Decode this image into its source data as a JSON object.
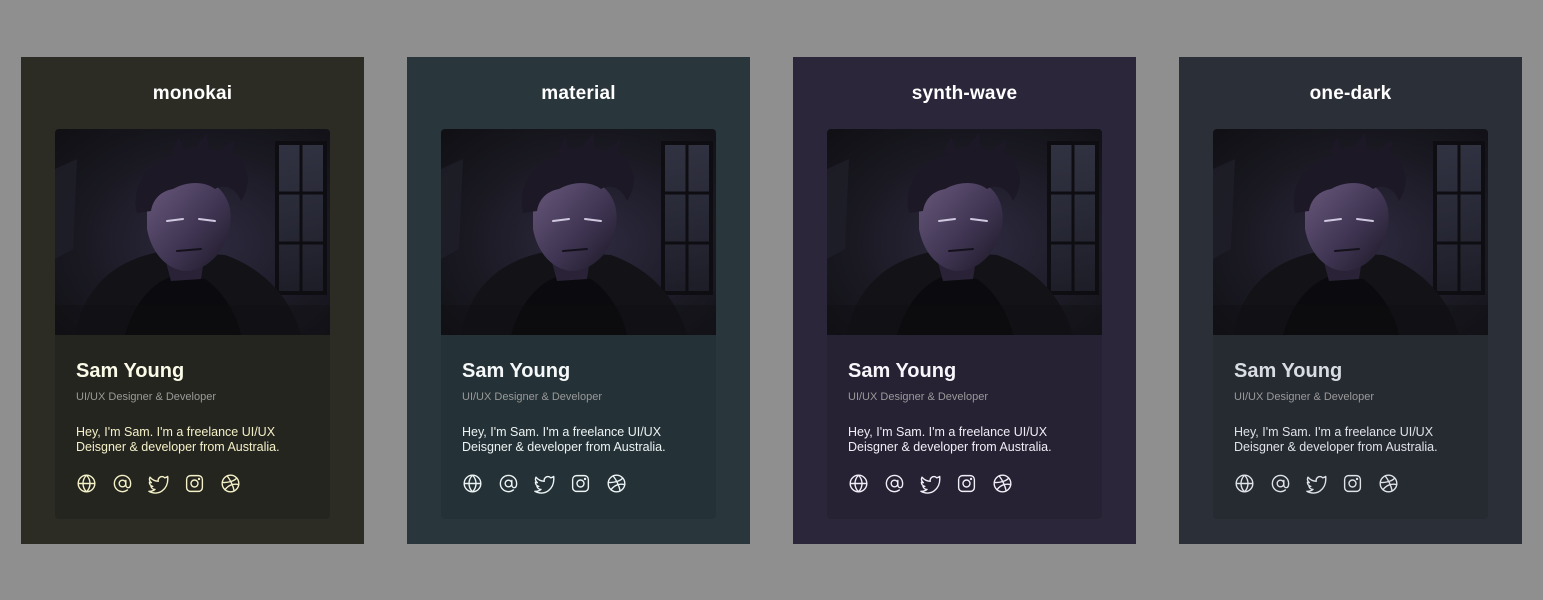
{
  "themes": [
    {
      "title": "monokai",
      "panel_bg": "#2c2c24",
      "card_bg": "#25251f",
      "name_color": "#fbfbe8",
      "bio_color": "#f4f0c8",
      "profile": {
        "name": "Sam Young",
        "role": "UI/UX Designer & Developer",
        "bio": "Hey, I'm Sam. I'm a freelance UI/UX Deisgner & developer from Australia."
      },
      "socials": [
        "globe-icon",
        "at-sign-icon",
        "twitter-icon",
        "instagram-icon",
        "dribbble-icon"
      ]
    },
    {
      "title": "material",
      "panel_bg": "#29363b",
      "card_bg": "#243136",
      "name_color": "#f5f8f8",
      "bio_color": "#ecf3f4",
      "profile": {
        "name": "Sam Young",
        "role": "UI/UX Designer & Developer",
        "bio": "Hey, I'm Sam. I'm a freelance UI/UX Deisgner & developer from Australia."
      },
      "socials": [
        "globe-icon",
        "at-sign-icon",
        "twitter-icon",
        "instagram-icon",
        "dribbble-icon"
      ]
    },
    {
      "title": "synth-wave",
      "panel_bg": "#2b263a",
      "card_bg": "#262133",
      "name_color": "#f8f6fb",
      "bio_color": "#f0eef6",
      "profile": {
        "name": "Sam Young",
        "role": "UI/UX Designer & Developer",
        "bio": "Hey, I'm Sam. I'm a freelance UI/UX Deisgner & developer from Australia."
      },
      "socials": [
        "globe-icon",
        "at-sign-icon",
        "twitter-icon",
        "instagram-icon",
        "dribbble-icon"
      ]
    },
    {
      "title": "one-dark",
      "panel_bg": "#2b2f37",
      "card_bg": "#262a31",
      "name_color": "#d9dde3",
      "bio_color": "#dfe3e8",
      "profile": {
        "name": "Sam Young",
        "role": "UI/UX Designer & Developer",
        "bio": "Hey, I'm Sam. I'm a freelance UI/UX Deisgner & developer from Australia."
      },
      "socials": [
        "globe-icon",
        "at-sign-icon",
        "twitter-icon",
        "instagram-icon",
        "dribbble-icon"
      ]
    }
  ]
}
